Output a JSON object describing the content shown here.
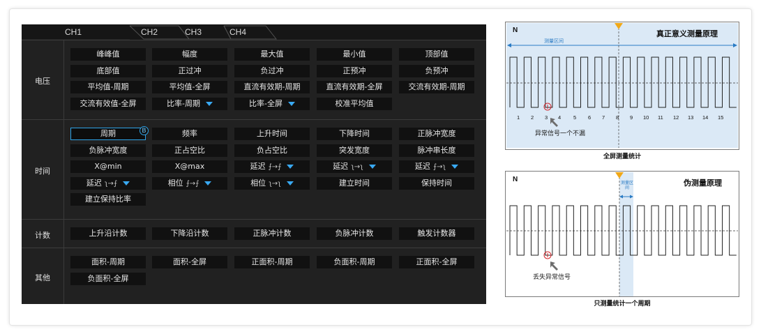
{
  "tabs": [
    "CH1",
    "CH2",
    "CH3",
    "CH4"
  ],
  "sections": [
    {
      "label": "电压",
      "rows": [
        [
          {
            "t": "峰峰值"
          },
          {
            "t": "幅度"
          },
          {
            "t": "最大值"
          },
          {
            "t": "最小值"
          },
          {
            "t": "顶部值"
          }
        ],
        [
          {
            "t": "底部值"
          },
          {
            "t": "正过冲"
          },
          {
            "t": "负过冲"
          },
          {
            "t": "正预冲"
          },
          {
            "t": "负预冲"
          }
        ],
        [
          {
            "t": "平均值-周期"
          },
          {
            "t": "平均值-全屏"
          },
          {
            "t": "直流有效期-周期"
          },
          {
            "t": "直流有效期-全屏"
          },
          {
            "t": "交流有效期-周期"
          }
        ],
        [
          {
            "t": "交流有效值-全屏"
          },
          {
            "t": "比率-周期",
            "dropdown": true
          },
          {
            "t": "比率-全屏",
            "dropdown": true
          },
          {
            "t": "校准平均值"
          }
        ]
      ]
    },
    {
      "label": "时间",
      "rows": [
        [
          {
            "t": "周期",
            "selected": true,
            "badge": "B"
          },
          {
            "t": "频率"
          },
          {
            "t": "上升时间"
          },
          {
            "t": "下降时间"
          },
          {
            "t": "正脉冲宽度"
          }
        ],
        [
          {
            "t": "负脉冲宽度"
          },
          {
            "t": "正占空比"
          },
          {
            "t": "负占空比"
          },
          {
            "t": "突发宽度"
          },
          {
            "t": "脉冲串长度"
          }
        ],
        [
          {
            "t": "X@min"
          },
          {
            "t": "X@max"
          },
          {
            "t": "延迟",
            "edge": "⨍→⨍",
            "dropdown": true
          },
          {
            "t": "延迟",
            "edge": "ʅ→ʅ",
            "dropdown": true
          },
          {
            "t": "延迟",
            "edge": "⨍→ʅ",
            "dropdown": true
          }
        ],
        [
          {
            "t": "延迟",
            "edge": "ʅ→⨍",
            "dropdown": true
          },
          {
            "t": "相位",
            "edge": "⨍→⨍",
            "dropdown": true
          },
          {
            "t": "相位",
            "edge": "ʅ→ʅ",
            "dropdown": true
          },
          {
            "t": "建立时间"
          },
          {
            "t": "保持时间"
          }
        ],
        [
          {
            "t": "建立保持比率"
          }
        ]
      ]
    },
    {
      "label": "计数",
      "rows": [
        [
          {
            "t": "上升沿计数"
          },
          {
            "t": "下降沿计数"
          },
          {
            "t": "正脉冲计数"
          },
          {
            "t": "负脉冲计数"
          },
          {
            "t": "触发计数器"
          }
        ]
      ]
    },
    {
      "label": "其他",
      "rows": [
        [
          {
            "t": "面积-周期"
          },
          {
            "t": "面积-全屏"
          },
          {
            "t": "正面积-周期"
          },
          {
            "t": "负面积-周期"
          },
          {
            "t": "正面积-全屏"
          }
        ],
        [
          {
            "t": "负面积-全屏"
          }
        ]
      ]
    }
  ],
  "diagram_top": {
    "n_label": "N",
    "title": "真正意义测量原理",
    "range_label": "测量区间",
    "pulse_numbers": [
      "1",
      "2",
      "3",
      "4",
      "5",
      "6",
      "7",
      "8",
      "9",
      "10",
      "11",
      "12",
      "13",
      "14",
      "15"
    ],
    "annotation": "异常信号一个不漏",
    "caption": "全屏测量统计"
  },
  "diagram_bottom": {
    "n_label": "N",
    "title": "伪测量原理",
    "range_label": "测量区间",
    "annotation": "丢失异常信号",
    "caption": "只测量统计一个周期"
  },
  "colors": {
    "accent_blue": "#2ea3e8",
    "trigger_orange": "#f0a818",
    "highlight_band": "#dbe9f6",
    "anomaly_red": "#d4252a"
  }
}
